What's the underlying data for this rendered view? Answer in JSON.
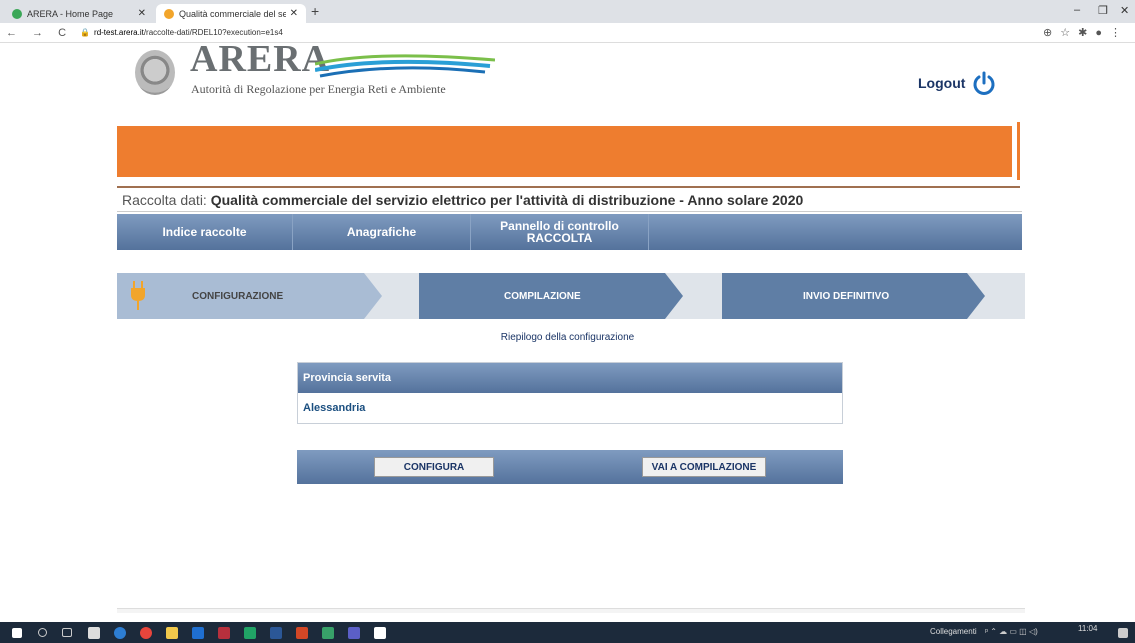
{
  "browser": {
    "tabs": [
      {
        "title": "ARERA - Home Page",
        "color": "#3aa757"
      },
      {
        "title": "Qualità commerciale del servizio",
        "color": "#f2a52b"
      }
    ],
    "new_tab": "+",
    "url_host": "rd-test.arera.it",
    "url_path": "/raccolte-dati/RDEL10?execution=e1s4",
    "nav_glyphs": "← → C",
    "window_controls": [
      "–",
      "❐",
      "✕"
    ]
  },
  "header": {
    "logo_word": "ARERA",
    "logo_subtitle": "Autorità di Regolazione per Energia Reti e Ambiente",
    "logout_label": "Logout"
  },
  "title": {
    "prefix": "Raccolta dati: ",
    "name": "Qualità commerciale del servizio elettrico per l'attività di distribuzione - Anno solare 2020"
  },
  "nav": {
    "items": [
      {
        "label": "Indice raccolte"
      },
      {
        "label": "Anagrafiche"
      },
      {
        "label_line1": "Pannello di controllo",
        "label_line2": "RACCOLTA"
      }
    ]
  },
  "steps": [
    {
      "label": "CONFIGURAZIONE",
      "state": "current"
    },
    {
      "label": "COMPILAZIONE",
      "state": "next"
    },
    {
      "label": "INVIO DEFINITIVO",
      "state": "next"
    }
  ],
  "summary": {
    "heading": "Riepilogo della configurazione",
    "table_header": "Provincia servita",
    "table_value": "Alessandria"
  },
  "buttons": {
    "configure": "CONFIGURA",
    "go_compile": "VAI A COMPILAZIONE"
  },
  "taskbar": {
    "links_label": "Collegamenti",
    "time": "11:04"
  },
  "colors": {
    "orange_banner": "#ee7d2f",
    "nav_blue": "#54729c",
    "step_dark": "#5f7ea5",
    "step_light": "#a9bcd4"
  }
}
